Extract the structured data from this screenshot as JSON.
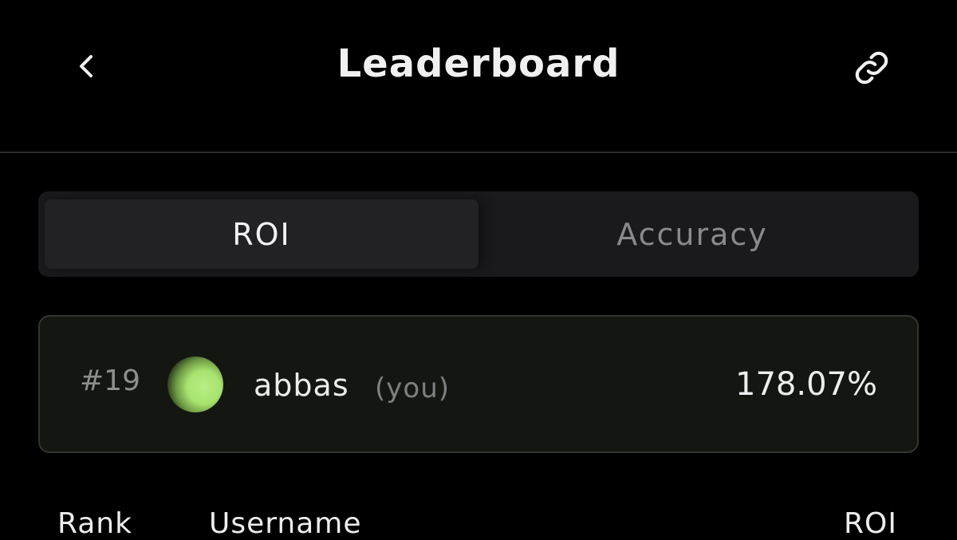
{
  "header": {
    "title": "Leaderboard",
    "back_icon": "chevron-left-icon",
    "link_icon": "link-icon"
  },
  "tabs": [
    {
      "label": "ROI",
      "selected": true
    },
    {
      "label": "Accuracy",
      "selected": false
    }
  ],
  "current_user": {
    "rank": "#19",
    "username": "abbas",
    "tag": "(you)",
    "roi": "178.07%",
    "avatar_colors": [
      "#b9ee83",
      "#0c0f08"
    ]
  },
  "table": {
    "columns": [
      "Rank",
      "Username",
      "ROI"
    ]
  },
  "colors": {
    "background": "#000000",
    "card_background": "#141711",
    "tab_background": "#1a1a1c",
    "accent_green": "#b9ee83"
  }
}
